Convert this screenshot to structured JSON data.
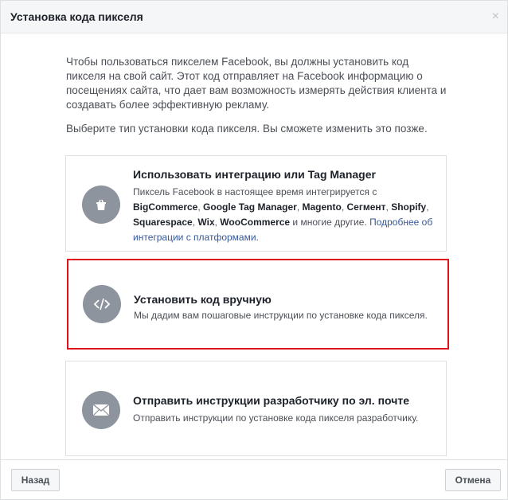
{
  "dialog": {
    "title": "Установка кода пикселя",
    "close_glyph": "×"
  },
  "intro_text": "Чтобы пользоваться пикселем Facebook, вы должны установить код пикселя на свой сайт. Этот код отправляет на Facebook информацию о посещениях сайта, что дает вам возможность измерять действия клиента и создавать более эффективную рекламу.",
  "choose_text": "Выберите тип установки кода пикселя. Вы сможете изменить это позже.",
  "options": [
    {
      "title": "Использовать интеграцию или Tag Manager",
      "icon": "shopping-bag-icon",
      "desc_prefix": "Пиксель Facebook в настоящее время интегрируется с ",
      "platforms": [
        "BigCommerce",
        "Google Tag Manager",
        "Magento",
        "Сегмент",
        "Shopify",
        "Squarespace",
        "Wix",
        "WooCommerce"
      ],
      "desc_suffix": " и многие другие. ",
      "link_text": "Подробнее об интеграции с платформами",
      "link_end": "."
    },
    {
      "title": "Установить код вручную",
      "icon": "code-icon",
      "desc": "Мы дадим вам пошаговые инструкции по установке кода пикселя."
    },
    {
      "title": "Отправить инструкции разработчику по эл. почте",
      "icon": "envelope-icon",
      "desc": "Отправить инструкции по установке кода пикселя разработчику."
    }
  ],
  "footer": {
    "back_label": "Назад",
    "cancel_label": "Отмена"
  },
  "colors": {
    "highlight_border": "#e0111b",
    "icon_circle": "#8d949e",
    "link": "#365899"
  }
}
